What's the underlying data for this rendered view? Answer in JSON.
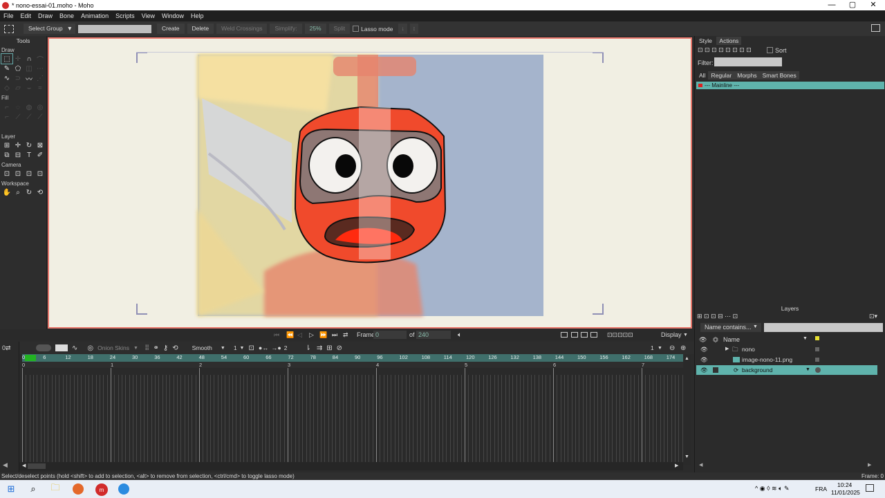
{
  "window": {
    "title": "* nono-essai-01.moho - Moho",
    "controls": [
      "—",
      "▢",
      "✕"
    ]
  },
  "menu": [
    "File",
    "Edit",
    "Draw",
    "Bone",
    "Animation",
    "Scripts",
    "View",
    "Window",
    "Help"
  ],
  "toolbar": {
    "mode_label": "Select Group",
    "group_field_value": "",
    "create": "Create",
    "delete": "Delete",
    "weld_crossings": "Weld Crossings",
    "simplify": "Simplify:",
    "simplify_value": "25%",
    "split": "Split",
    "lasso_mode": "Lasso mode"
  },
  "tools": {
    "title": "Tools",
    "sections": {
      "draw": "Draw",
      "fill": "Fill",
      "layer": "Layer",
      "camera": "Camera",
      "workspace": "Workspace"
    }
  },
  "transport": {
    "frame_label": "Frame",
    "frame_value": "0",
    "of_label": "of",
    "total_frames": "240",
    "display": "Display"
  },
  "timeline": {
    "onion_skins": "Onion Skins",
    "interpolation": "Smooth",
    "interp_value": "1",
    "keys_value": "2",
    "zoom_value": "1",
    "ruler_ticks": [
      "0",
      "6",
      "12",
      "18",
      "24",
      "30",
      "36",
      "42",
      "48",
      "54",
      "60",
      "66",
      "72",
      "78",
      "84",
      "90",
      "96",
      "102",
      "108",
      "114",
      "120",
      "126",
      "132",
      "138",
      "144",
      "150",
      "156",
      "162",
      "168",
      "174"
    ],
    "seconds": [
      "0",
      "1",
      "2",
      "3",
      "4",
      "5",
      "6",
      "7"
    ]
  },
  "status": {
    "hint": "Select/deselect points (hold <shift> to add to selection, <alt> to remove from selection, <ctrl/cmd> to toggle lasso mode)",
    "frame": "Frame: 0"
  },
  "style_panel": {
    "tabs": [
      "Style",
      "Actions"
    ],
    "sort": "Sort",
    "filter_label": "Filter:",
    "subtabs": [
      "All",
      "Regular",
      "Morphs",
      "Smart Bones"
    ],
    "mainline": "--- Mainline ---"
  },
  "layers_panel": {
    "title": "Layers",
    "name_contains": "Name contains...",
    "name_header": "Name",
    "layers": [
      {
        "name": "nono",
        "type": "group"
      },
      {
        "name": "image-nono-11.png",
        "type": "image"
      },
      {
        "name": "background",
        "type": "vector",
        "selected": true
      }
    ]
  },
  "taskbar": {
    "lang": "FRA",
    "time": "10:24",
    "date": "11/01/2025"
  },
  "colors": {
    "accent": "#5fb3ac",
    "stage_border": "#e8766b",
    "canvas_bg": "#f1efe3",
    "mask_red": "#f04a2c"
  }
}
